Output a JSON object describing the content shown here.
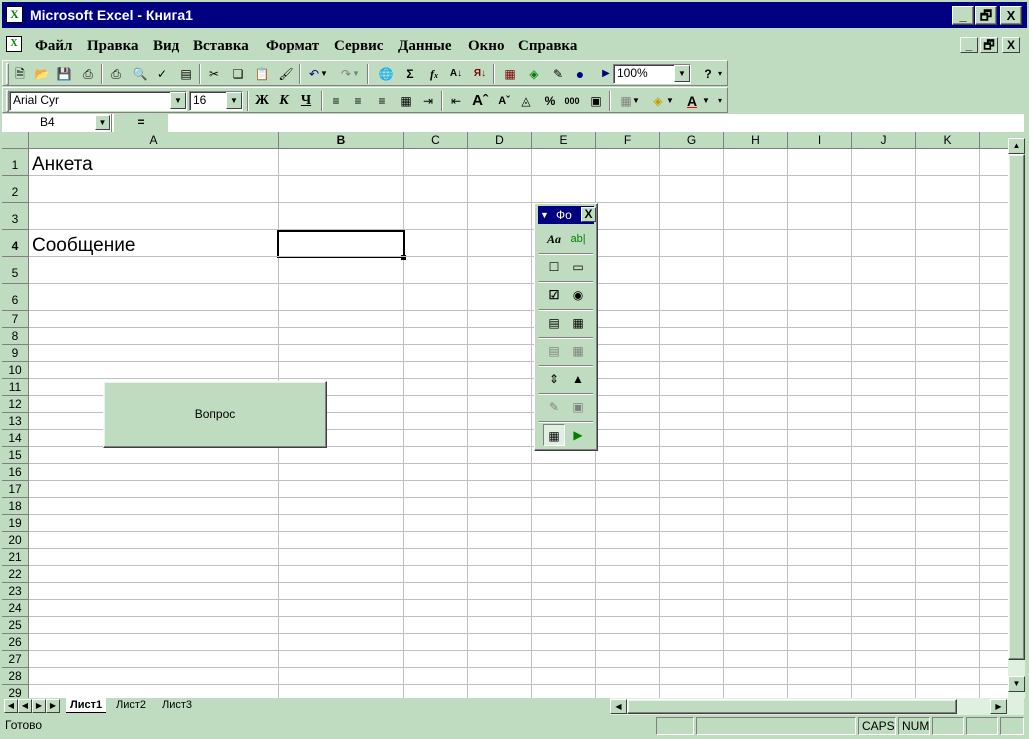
{
  "window": {
    "title": "Microsoft Excel - Книга1",
    "app_icon": "excel-icon",
    "controls": {
      "minimize": "_",
      "restore": "🗗",
      "close": "X"
    }
  },
  "menubar": {
    "items": [
      "Файл",
      "Правка",
      "Вид",
      "Вставка",
      "Формат",
      "Сервис",
      "Данные",
      "Окно",
      "Справка"
    ],
    "doc_controls": {
      "minimize": "_",
      "restore": "🗗",
      "close": "X"
    }
  },
  "standard_toolbar": {
    "icons": [
      "new-icon",
      "open-icon",
      "save-icon",
      "print-preview-icon",
      "print-icon",
      "preview-icon",
      "spelling-icon",
      "research-icon",
      "cut-icon",
      "copy-icon",
      "paste-icon",
      "format-painter-icon",
      "undo-icon",
      "redo-icon",
      "hyperlink-icon",
      "autosum-icon",
      "function-icon",
      "sort-asc-icon",
      "sort-desc-icon",
      "chart-wizard-icon",
      "map-icon",
      "drawing-icon"
    ],
    "zoom": "100%",
    "help_label": "?"
  },
  "formatting_toolbar": {
    "font": "Arial Cyr",
    "size": "16",
    "bold": "Ж",
    "italic": "К",
    "underline": "Ч",
    "percent": "%",
    "thousands": "000"
  },
  "formula_bar": {
    "name_box": "B4",
    "equals": "="
  },
  "sheet": {
    "columns": [
      "A",
      "B",
      "C",
      "D",
      "E",
      "F",
      "G",
      "H",
      "I",
      "J",
      "K"
    ],
    "rows": [
      "1",
      "2",
      "3",
      "4",
      "5",
      "6",
      "7",
      "8",
      "9",
      "10",
      "11",
      "12",
      "13",
      "14",
      "15",
      "16",
      "17",
      "18",
      "19",
      "20",
      "21",
      "22",
      "23",
      "24",
      "25",
      "26",
      "27",
      "28",
      "29"
    ],
    "cells": {
      "A1": "Анкета",
      "A4": "Сообщение"
    },
    "selected_cell": "B4",
    "button_label": "Вопрос"
  },
  "forms_toolbar": {
    "title": "Фо",
    "close": "X",
    "label_glyph": "Aa",
    "editbox_glyph": "ab|"
  },
  "sheet_tabs": [
    "Лист1",
    "Лист2",
    "Лист3"
  ],
  "status_bar": {
    "ready": "Готово",
    "caps": "CAPS",
    "num": "NUM"
  }
}
